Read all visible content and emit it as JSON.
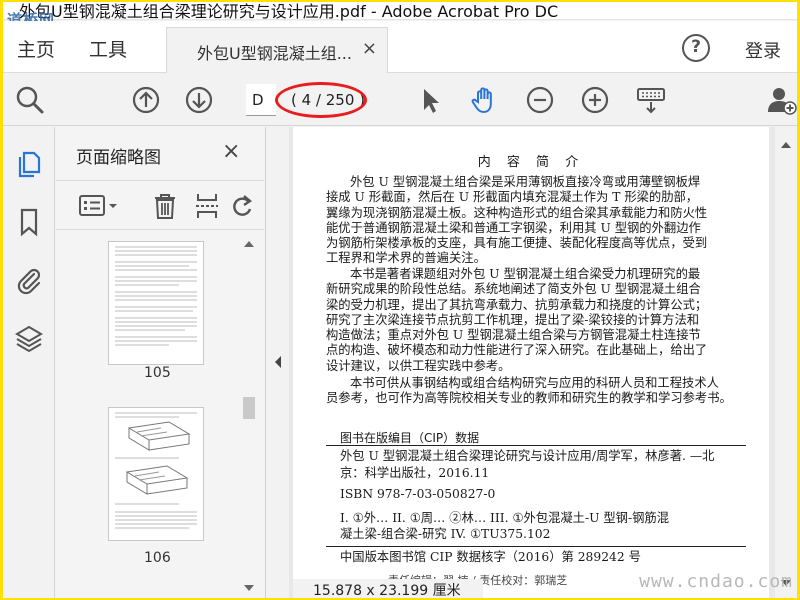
{
  "window": {
    "title": "外包U型钢混凝土组合梁理论研究与设计应用.pdf - Adobe Acrobat Pro DC",
    "watermark_top": "道桥网",
    "watermark_bottom": "www.cndao.com"
  },
  "menubar": {
    "home_label": "主页",
    "tools_label": "工具",
    "doc_tab_label": "外包U型钢混凝土组...",
    "doc_tab_close": "×",
    "help_label": "?",
    "login_label": "登录"
  },
  "toolbar": {
    "page_input_value": "D",
    "page_count": "( 4 / 250 )",
    "icons": [
      "search-zoom-icon",
      "page-up-icon",
      "page-down-icon",
      "select-cursor-icon",
      "hand-tool-icon",
      "zoom-out-icon",
      "zoom-in-icon",
      "keyboard-scroll-icon",
      "add-user-icon"
    ]
  },
  "thumbnail_panel": {
    "title": "页面缩略图",
    "close": "×",
    "thumbnails": [
      {
        "label": "105"
      },
      {
        "label": "106"
      }
    ]
  },
  "document": {
    "heading": "内 容 简 介",
    "paragraph1_lines": [
      "外包 U 型钢混凝土组合梁是采用薄钢板直接冷弯或用薄壁钢板焊",
      "接成 U 形截面，然后在 U 形截面内填充混凝土作为 T 形梁的肋部，",
      "翼缘为现浇钢筋混凝土板。这种构造形式的组合梁其承载能力和防火性",
      "能优于普通钢筋混凝土梁和普通工字钢梁，利用其 U 型钢的外翻边作",
      "为钢筋桁架楼承板的支座，具有施工便捷、装配化程度高等优点，受到",
      "工程界和学术界的普遍关注。"
    ],
    "paragraph2_lines": [
      "本书是著者课题组对外包 U 型钢混凝土组合梁受力机理研究的最",
      "新研究成果的阶段性总结。系统地阐述了简支外包 U 型钢混凝土组合",
      "梁的受力机理，提出了其抗弯承载力、抗剪承载力和挠度的计算公式；",
      "研究了主次梁连接节点抗剪工作机理，提出了梁-梁铰接的计算方法和",
      "构造做法；重点对外包 U 型钢混凝土组合梁与方钢管混凝土柱连接节",
      "点的构造、破坏模态和动力性能进行了深入研究。在此基础上，给出了",
      "设计建议，以供工程实践中参考。"
    ],
    "paragraph3_lines": [
      "本书可供从事钢结构或组合结构研究与应用的科研人员和工程技术人",
      "员参考，也可作为高等院校相关专业的教师和研究生的教学和学习参考书。"
    ],
    "cip_title": "图书在版编目（CIP）数据",
    "cip_lines": [
      "外包 U 型钢混凝土组合梁理论研究与设计应用/周学军，林彦著. —北",
      "京：科学出版社，2016.11",
      "ISBN 978-7-03-050827-0",
      "I. ①外…  II. ①周…  ②林…  III. ①外包混凝土-U 型钢-钢筋混",
      "凝土梁-组合梁-研究   IV. ①TU375.102"
    ],
    "cip_footer": "中国版本图书馆 CIP 数据核字（2016）第 289242 号",
    "cut_line": "责任编辑：翟 楠 / 责任校对：郭瑞芝"
  },
  "statusbar": {
    "dimensions": "15.878 x 23.199 厘米"
  },
  "colors": {
    "frame_border": "#ffe000",
    "highlight_ellipse": "#e81d1d",
    "accent_blue": "#2a74d6"
  }
}
